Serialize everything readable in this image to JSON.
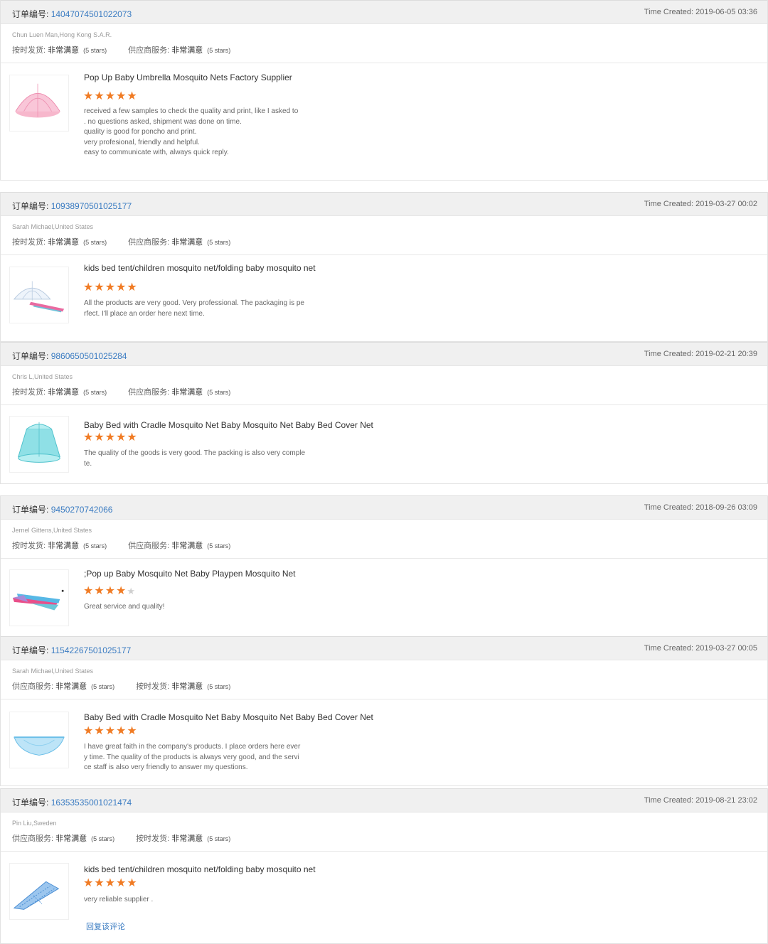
{
  "order_label": "订单编号:",
  "time_label": "Time Created:",
  "reply_label": "回复该评论",
  "colors": {
    "accent": "#3b7cc2",
    "star": "#f07b24",
    "header_bg": "#f0f0f0"
  },
  "reviews": [
    {
      "order_number": "14047074501022073",
      "time": "2019-06-05 03:36",
      "buyer": "Chun Luen Man,Hong Kong S.A.R.",
      "ratings": [
        {
          "label": "按时发货:",
          "value": "非常满意",
          "stars": "(5 stars)"
        },
        {
          "label": "供应商服务:",
          "value": "非常满意",
          "stars": "(5 stars)"
        }
      ],
      "product_title": "Pop Up Baby Umbrella Mosquito Nets Factory Supplier",
      "product_icon": "pink-mosquito-net-icon",
      "rating": 5,
      "text": "received a few samples to check the quality and print, like I asked to. no questions asked, shipment was done on time.\nquality is good for poncho and print.\nvery profesional, friendly and helpful.\neasy to communicate with, always quick reply."
    },
    {
      "order_number": "10938970501025177",
      "time": "2019-03-27 00:02",
      "buyer": "Sarah Michael,United States",
      "ratings": [
        {
          "label": "按时发货:",
          "value": "非常满意",
          "stars": "(5 stars)"
        },
        {
          "label": "供应商服务:",
          "value": "非常满意",
          "stars": "(5 stars)"
        }
      ],
      "product_title": "kids bed tent/children mosquito net/folding baby mosquito net",
      "product_icon": "white-mosquito-net-icon",
      "rating": 5,
      "text": "All the products are very good. Very professional. The packaging is perfect. I'll place an order here next time."
    },
    {
      "order_number": "9860650501025284",
      "time": "2019-02-21 20:39",
      "buyer": "Chris L,United States",
      "ratings": [
        {
          "label": "按时发货:",
          "value": "非常满意",
          "stars": "(5 stars)"
        },
        {
          "label": "供应商服务:",
          "value": "非常满意",
          "stars": "(5 stars)"
        }
      ],
      "product_title": "Baby Bed with Cradle Mosquito Net Baby Mosquito Net Baby Bed Cover Net",
      "product_icon": "teal-mosquito-net-icon",
      "rating": 5,
      "text": "The quality of the goods is very good. The packing is also very complete."
    },
    {
      "order_number": "9450270742066",
      "time": "2018-09-26 03:09",
      "buyer": "Jernel Gittens,United States",
      "ratings": [
        {
          "label": "按时发货:",
          "value": "非常满意",
          "stars": "(5 stars)"
        },
        {
          "label": "供应商服务:",
          "value": "非常满意",
          "stars": "(5 stars)"
        }
      ],
      "product_title": ";Pop up Baby Mosquito Net Baby Playpen Mosquito Net",
      "product_icon": "folded-colorful-net-icon",
      "rating": 4,
      "text": "Great service and quality!"
    },
    {
      "order_number": "11542267501025177",
      "time": "2019-03-27 00:05",
      "buyer": "Sarah Michael,United States",
      "ratings": [
        {
          "label": "供应商服务:",
          "value": "非常满意",
          "stars": "(5 stars)"
        },
        {
          "label": "按时发货:",
          "value": "非常满意",
          "stars": "(5 stars)"
        }
      ],
      "product_title": "Baby Bed with Cradle Mosquito Net Baby Mosquito Net Baby Bed Cover Net",
      "product_icon": "blue-cradle-net-icon",
      "rating": 5,
      "text": "I have great faith in the company's products. I place orders here every time. The quality of the products is always very good, and the service staff is also very friendly to answer my questions."
    },
    {
      "order_number": "16353535001021474",
      "time": "2019-08-21 23:02",
      "buyer": "Pin Liu,Sweden",
      "ratings": [
        {
          "label": "供应商服务:",
          "value": "非常满意",
          "stars": "(5 stars)"
        },
        {
          "label": "按时发货:",
          "value": "非常满意",
          "stars": "(5 stars)"
        }
      ],
      "product_title": "kids bed tent/children mosquito net/folding baby mosquito net",
      "product_icon": "blue-pattern-net-icon",
      "rating": 5,
      "text": "very reliable supplier ."
    }
  ]
}
